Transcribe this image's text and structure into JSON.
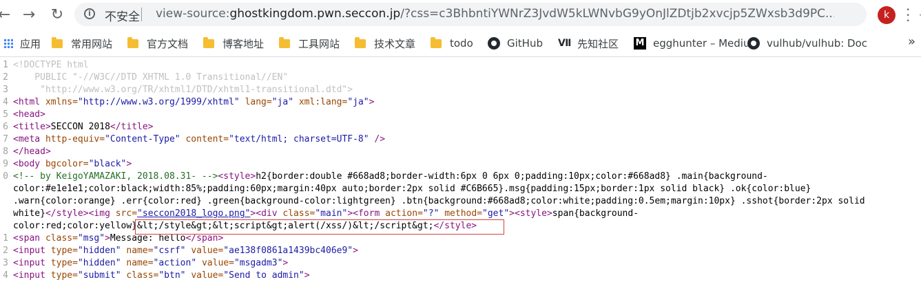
{
  "toolbar": {
    "back_icon": "arrow-left-icon",
    "forward_icon": "arrow-right-icon",
    "reload_icon": "reload-icon",
    "security_label": "不安全",
    "url_prefix": "view-source:",
    "url_domain": "ghostkingdom.pwn.seccon.jp",
    "url_rest": "/?css=c3BhbntiYWNrZ3JvdW5kLWNvbG9yOnJlZDtjb2xvcjp5ZWxsb3d9PC...",
    "avatar_letter": "k"
  },
  "bookmarks": [
    {
      "label": "应用",
      "icon": "apps-grid-icon"
    },
    {
      "label": "常用网站",
      "icon": "folder-icon"
    },
    {
      "label": "官方文档",
      "icon": "folder-icon"
    },
    {
      "label": "博客地址",
      "icon": "folder-icon"
    },
    {
      "label": "工具网站",
      "icon": "folder-icon"
    },
    {
      "label": "技术文章",
      "icon": "folder-icon"
    },
    {
      "label": "todo",
      "icon": "folder-icon"
    },
    {
      "label": "GitHub",
      "icon": "github-icon"
    },
    {
      "label": "先知社区",
      "icon": "xianzhi-icon"
    },
    {
      "label": "egghunter – Mediu",
      "icon": "medium-icon"
    },
    {
      "label": "vulhub/vulhub: Doc",
      "icon": "github-icon"
    }
  ],
  "source": {
    "line_numbers": [
      "1",
      "2",
      "3",
      "4",
      "5",
      "6",
      "7",
      "8",
      "9",
      "0",
      "",
      "",
      "",
      "",
      "1",
      "2",
      "3",
      "4"
    ],
    "l1": "<!DOCTYPE html",
    "l2": "    PUBLIC \"-//W3C//DTD XHTML 1.0 Transitional//EN\"",
    "l3": "     \"http://www.w3.org/TR/xhtml1/DTD/xhtml1-transitional.dtd\">",
    "l4_tag": "<html ",
    "l4_a1": "xmlns=",
    "l4_v1": "\"http://www.w3.org/1999/xhtml\"",
    "l4_a2": " lang=",
    "l4_v2": "\"ja\"",
    "l4_a3": " xml:lang=",
    "l4_v3": "\"ja\"",
    "l4_end": ">",
    "l5": "<head>",
    "l6_open": "<title>",
    "l6_text": "SECCON 2018",
    "l6_close": "</title>",
    "l7_tag": "<meta ",
    "l7_a1": "http-equiv=",
    "l7_v1": "\"Content-Type\"",
    "l7_a2": " content=",
    "l7_v2": "\"text/html; charset=UTF-8\"",
    "l7_end": " />",
    "l8": "</head>",
    "l9_tag": "<body ",
    "l9_a1": "bgcolor=",
    "l9_v1": "\"black\"",
    "l9_end": ">",
    "l10_comment": "<!-- by KeigoYAMAZAKI, 2018.08.31- -->",
    "l10_style": "<style>",
    "l10_css": "h2{border:double #668ad8;border-width:6px 0 6px 0;padding:10px;color:#668ad8} .main{background-",
    "l11_css": "color:#e1e1e1;color:black;width:85%;padding:60px;margin:40px auto;border:2px solid #C6B665}.msg{padding:15px;border:1px solid black} .ok{color:blue}",
    "l12_css": ".warn{color:orange} .err{color:red} .green{background-color:lightgreen} .btn{background:#668ad8;color:white;padding:0.5em;margin:10px} .sshot{border:2px solid",
    "l13_css": "white}",
    "l13_style_close": "</style>",
    "l13_img": "<img ",
    "l13_src_a": "src=",
    "l13_src_v": "\"seccon2018_logo.png\"",
    "l13_img_end": ">",
    "l13_div": "<div ",
    "l13_div_a": "class=",
    "l13_div_v": "\"main\"",
    "l13_div_end": ">",
    "l13_form": "<form ",
    "l13_form_a1": "action=",
    "l13_form_v1": "\"?\"",
    "l13_form_a2": " method=",
    "l13_form_v2": "\"get\"",
    "l13_form_end": ">",
    "l13_style2": "<style>",
    "l13_css2": "span{background-",
    "l14_css": "color:red;color:yellow}",
    "l14_payload": "&lt;/style&gt;&lt;script&gt;alert(/xss/)&lt;/script&gt;",
    "l14_style_close": "</style>",
    "l15_tag": "<span ",
    "l15_a": "class=",
    "l15_v": "\"msg\"",
    "l15_end": ">",
    "l15_text": "Message: hello",
    "l15_close": "</span>",
    "l16_tag": "<input ",
    "l16_a1": "type=",
    "l16_v1": "\"hidden\"",
    "l16_a2": " name=",
    "l16_v2": "\"csrf\"",
    "l16_a3": " value=",
    "l16_v3": "\"ae138f0861a1439bc406e9\"",
    "l16_end": ">",
    "l17_tag": "<input ",
    "l17_a1": "type=",
    "l17_v1": "\"hidden\"",
    "l17_a2": " name=",
    "l17_v2": "\"action\"",
    "l17_a3": " value=",
    "l17_v3": "\"msgadm3\"",
    "l17_end": ">",
    "l18_tag": "<input ",
    "l18_a1": "type=",
    "l18_v1": "\"submit\"",
    "l18_a2": " class=",
    "l18_v2": "\"btn\"",
    "l18_a3": " value=",
    "l18_v3": "\"Send to admin\"",
    "l18_end": ">"
  }
}
